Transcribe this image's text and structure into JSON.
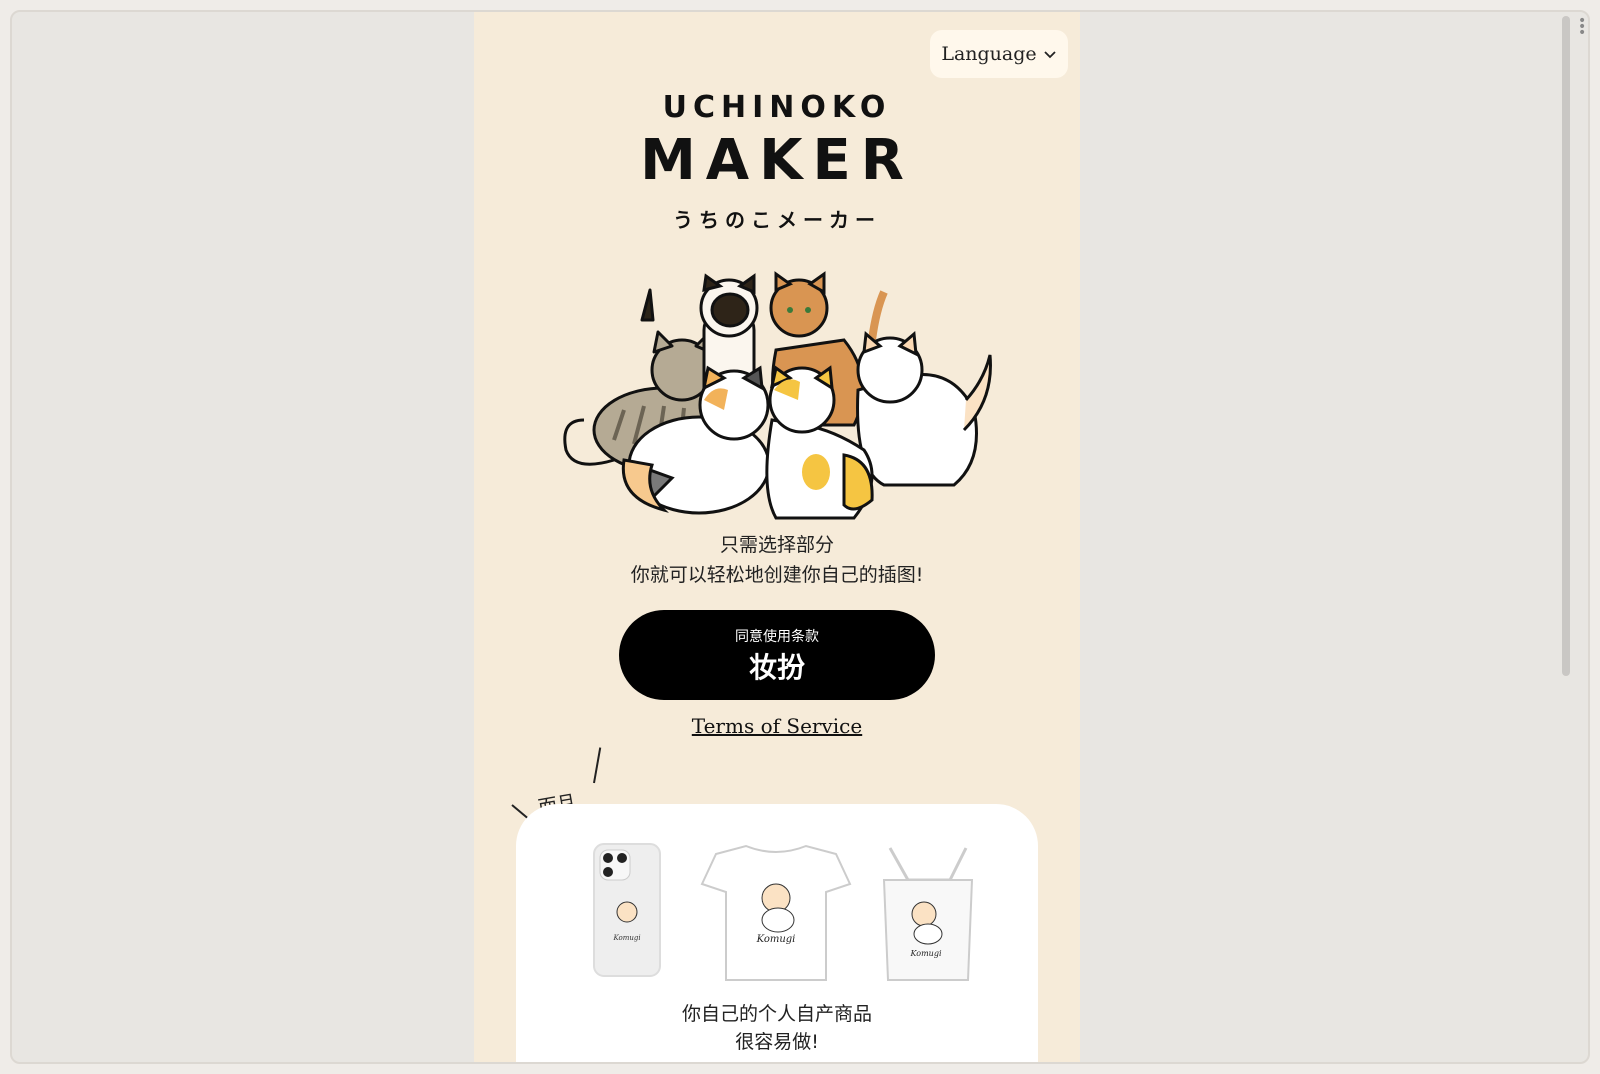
{
  "language_button": {
    "label": "Language",
    "icon": "chevron-down-icon"
  },
  "logo": {
    "top": "UCHINOKO",
    "main": "MAKER",
    "sub": "うちのこメーカー"
  },
  "tagline": {
    "line1": "只需选择部分",
    "line2": "你就可以轻松地创建你自己的插图!"
  },
  "cta": {
    "small": "同意使用条款",
    "big": "妆扮"
  },
  "terms_link": "Terms of Service",
  "goods": {
    "label": "而且",
    "caption_line1": "你自己的个人自产商品",
    "caption_line2": "很容易做!",
    "item_text": "Komugi"
  },
  "colors": {
    "page_bg": "#f6ebd9",
    "button_bg": "#000000",
    "card_bg": "#ffffff"
  }
}
